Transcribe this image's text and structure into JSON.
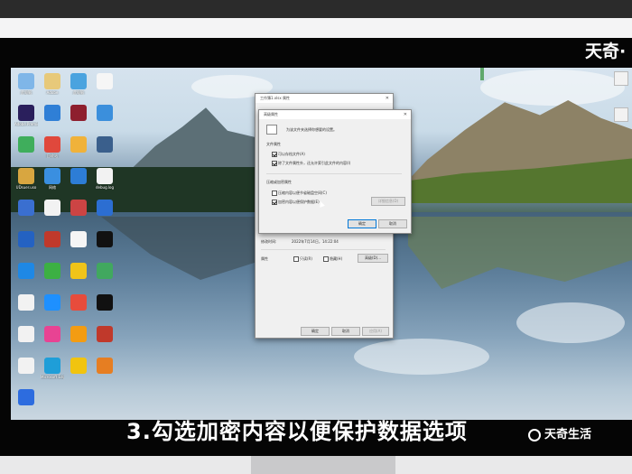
{
  "overlay": {
    "brand_top": "天奇·",
    "caption": "3.勾选加密内容以便保护数据选项",
    "brand_bottom": "天奇生活"
  },
  "desktop_icons": [
    {
      "label": "此电脑",
      "color": "#7fb6e8"
    },
    {
      "label": "Adobe",
      "color": "#e7c97a"
    },
    {
      "label": "此电脑",
      "color": "#4aa3df"
    },
    {
      "label": "",
      "color": "#f6f6f6"
    },
    {
      "label": "Adobe Premie",
      "color": "#2a1f5c"
    },
    {
      "label": "",
      "color": "#2f7fd6"
    },
    {
      "label": "",
      "color": "#8e1f2e"
    },
    {
      "label": "",
      "color": "#3b8fdc"
    },
    {
      "label": "",
      "color": "#3fae5c"
    },
    {
      "label": "回收站",
      "color": "#e0483c"
    },
    {
      "label": "",
      "color": "#f0b23a"
    },
    {
      "label": "",
      "color": "#3a5f8c"
    },
    {
      "label": "UDsuer.uso",
      "color": "#d8a640"
    },
    {
      "label": "网络",
      "color": "#3a8fe0"
    },
    {
      "label": "",
      "color": "#2d7dd6"
    },
    {
      "label": "debug.log",
      "color": "#f2f2f2"
    },
    {
      "label": "",
      "color": "#3a6fd0"
    },
    {
      "label": "",
      "color": "#f2f2f2"
    },
    {
      "label": "",
      "color": "#c44"
    },
    {
      "label": "",
      "color": "#2c6ed2"
    },
    {
      "label": "",
      "color": "#2462c2"
    },
    {
      "label": "",
      "color": "#c0392b"
    },
    {
      "label": "",
      "color": "#f5f5f5"
    },
    {
      "label": "",
      "color": "#111"
    },
    {
      "label": "",
      "color": "#1e88e5"
    },
    {
      "label": "",
      "color": "#3cb043"
    },
    {
      "label": "",
      "color": "#f0c419"
    },
    {
      "label": "",
      "color": "#41a85f"
    },
    {
      "label": "",
      "color": "#f2f2f2"
    },
    {
      "label": "",
      "color": "#1e90ff"
    },
    {
      "label": "",
      "color": "#e74c3c"
    },
    {
      "label": "",
      "color": "#111"
    },
    {
      "label": "",
      "color": "#f2f2f2"
    },
    {
      "label": "",
      "color": "#e84393"
    },
    {
      "label": "",
      "color": "#f39c12"
    },
    {
      "label": "",
      "color": "#c0392b"
    },
    {
      "label": "",
      "color": "#f2f2f2"
    },
    {
      "label": "Microsoft Edge",
      "color": "#1f9ed8"
    },
    {
      "label": "",
      "color": "#f1c40f"
    },
    {
      "label": "",
      "color": "#e67e22"
    },
    {
      "label": "",
      "color": "#2d6cdf"
    }
  ],
  "props_window": {
    "title": "工作簿1.xlsx 属性",
    "date": "2022年7月14日，14:22:04",
    "attr_label": "属性",
    "readonly_label": "只读(R)",
    "hidden_label": "隐藏(H)",
    "advanced_label": "高级(D)...",
    "ok": "确定",
    "cancel": "取消",
    "apply": "应用(A)"
  },
  "adv_dialog": {
    "title": "高级属性",
    "desc": "为该文件夹选择你想要的设置。",
    "section1": "文件属性",
    "chk_archive": "可以存档文件(A)",
    "chk_index": "除了文件属性外，还允许索引此文件的内容(I)",
    "section2": "压缩或加密属性",
    "chk_compress": "压缩内容以便节省磁盘空间(C)",
    "chk_encrypt": "加密内容以便保护数据(E)",
    "details": "详细信息(D)",
    "ok": "确定",
    "cancel": "取消",
    "checked": {
      "archive": true,
      "index": true,
      "compress": false,
      "encrypt": true
    }
  }
}
